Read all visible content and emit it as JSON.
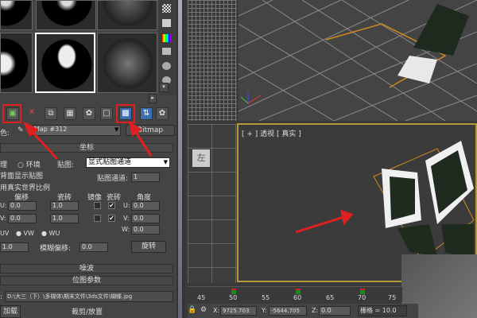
{
  "toolbar": {
    "map_color_label": "色:",
    "map_name": "Map #312",
    "map_type": "Bitmap"
  },
  "coordinates": {
    "title": "坐标",
    "texture_label": "理",
    "env_label": "环境",
    "mapping_label": "贴图:",
    "mapping_value": "显式贴图通道",
    "show_back_label": "背面显示贴图",
    "map_channel_label": "贴图通道:",
    "map_channel": "1",
    "real_world_label": "用真实世界比例",
    "offset_label": "偏移",
    "tiling_label": "瓷砖",
    "mirror_label": "镜像",
    "tile_label": "瓷砖",
    "angle_label": "角度",
    "u_label": "U:",
    "v_label": "V:",
    "w_label": "W:",
    "u_offset": "0.0",
    "v_offset": "0.0",
    "u_tiling": "1.0",
    "v_tiling": "1.0",
    "angle_u": "0.0",
    "angle_v": "0.0",
    "angle_w": "0.0",
    "uv": "UV",
    "vw": "VW",
    "wu": "WU",
    "blur": "1.0",
    "blur_offset_label": "模糊偏移:",
    "blur_offset": "0.0",
    "rotate_label": "旋转"
  },
  "rollouts": {
    "noise": "噪波",
    "bitmap_params": "位图参数"
  },
  "bitmap": {
    "path": "D:\\大三（下）\\多媒体\\期末文件\\3ds文件\\蝴蝶.jpg",
    "reload_label": "加载",
    "crop_label": "裁剪/放置"
  },
  "viewport": {
    "label": "[ + ] 透视 [ 真实 ]",
    "left_cube": "左"
  },
  "timeline": {
    "ticks": [
      "45",
      "50",
      "55",
      "60",
      "65",
      "70",
      "75"
    ]
  },
  "status": {
    "x_label": "X:",
    "x": "9725.703",
    "y_label": "Y:",
    "y": "-5644.705",
    "z_label": "Z:",
    "z": "0.0",
    "grid": "栅格 = 10.0"
  },
  "colors": {
    "accent": "#e02020",
    "active_border": "#b59a3a"
  }
}
